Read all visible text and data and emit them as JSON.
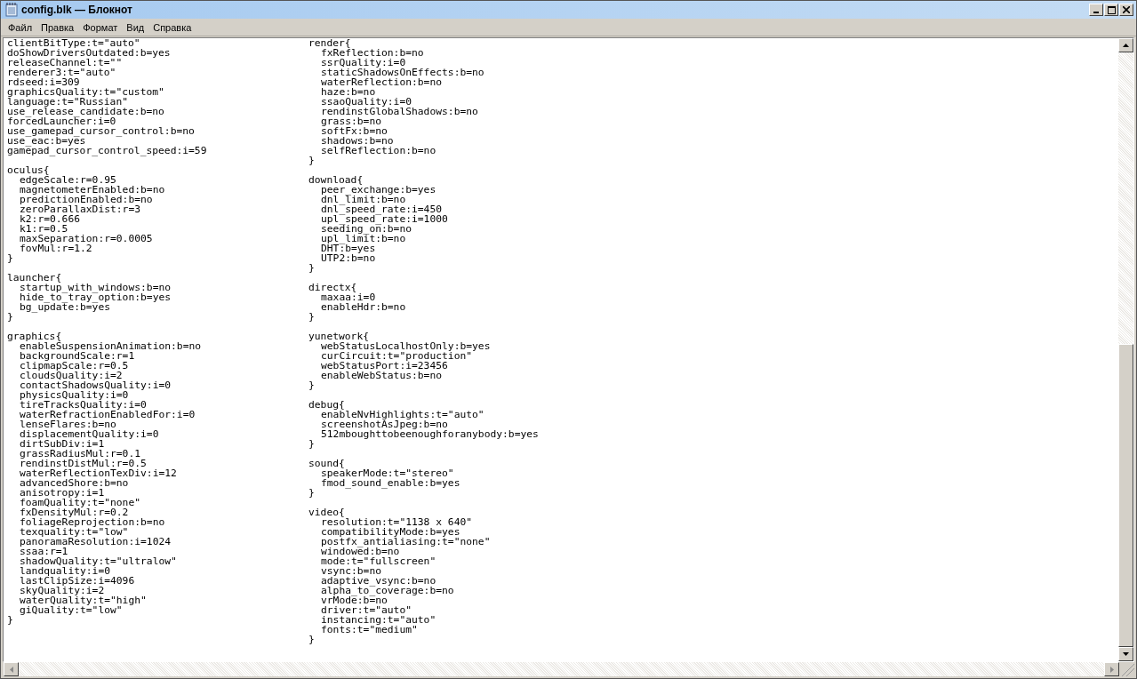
{
  "window": {
    "title": "config.blk — Блокнот"
  },
  "menu": [
    {
      "label": "Файл"
    },
    {
      "label": "Правка"
    },
    {
      "label": "Формат"
    },
    {
      "label": "Вид"
    },
    {
      "label": "Справка"
    }
  ],
  "editor": {
    "columns": [
      [
        {
          "entries": [
            "clientBitType:t=\"auto\"",
            "doShowDriversOutdated:b=yes",
            "releaseChannel:t=\"\"",
            "renderer3:t=\"auto\"",
            "rdseed:i=309",
            "graphicsQuality:t=\"custom\"",
            "language:t=\"Russian\"",
            "use_release_candidate:b=no",
            "forcedLauncher:i=0",
            "use_gamepad_cursor_control:b=no",
            "use_eac:b=yes",
            "gamepad_cursor_control_speed:i=59"
          ]
        },
        {
          "header": "oculus{",
          "entries": [
            "edgeScale:r=0.95",
            "magnetometerEnabled:b=no",
            "predictionEnabled:b=no",
            "zeroParallaxDist:r=3",
            "k2:r=0.666",
            "k1:r=0.5",
            "maxSeparation:r=0.0005",
            "fovMul:r=1.2"
          ],
          "footer": "}"
        },
        {
          "header": "launcher{",
          "entries": [
            "startup_with_windows:b=no",
            "hide_to_tray_option:b=yes",
            "bg_update:b=yes"
          ],
          "footer": "}"
        },
        {
          "header": "graphics{",
          "entries": [
            "enableSuspensionAnimation:b=no",
            "backgroundScale:r=1",
            "clipmapScale:r=0.5",
            "cloudsQuality:i=2",
            "contactShadowsQuality:i=0",
            "physicsQuality:i=0",
            "tireTracksQuality:i=0",
            "waterRefractionEnabledFor:i=0",
            "lenseFlares:b=no",
            "displacementQuality:i=0",
            "dirtSubDiv:i=1",
            "grassRadiusMul:r=0.1",
            "rendinstDistMul:r=0.5",
            "waterReflectionTexDiv:i=12",
            "advancedShore:b=no",
            "anisotropy:i=1",
            "foamQuality:t=\"none\"",
            "fxDensityMul:r=0.2",
            "foliageReprojection:b=no",
            "texquality:t=\"low\"",
            "panoramaResolution:i=1024",
            "ssaa:r=1",
            "shadowQuality:t=\"ultralow\"",
            "landquality:i=0",
            "lastClipSize:i=4096",
            "skyQuality:i=2",
            "waterQuality:t=\"high\"",
            "giQuality:t=\"low\""
          ],
          "footer": "}"
        }
      ],
      [
        {
          "header": "render{",
          "entries": [
            "fxReflection:b=no",
            "ssrQuality:i=0",
            "staticShadowsOnEffects:b=no",
            "waterReflection:b=no",
            "haze:b=no",
            "ssaoQuality:i=0",
            "rendinstGlobalShadows:b=no",
            "grass:b=no",
            "softFx:b=no",
            "shadows:b=no",
            "selfReflection:b=no"
          ],
          "footer": "}"
        },
        {
          "header": "download{",
          "entries": [
            "peer_exchange:b=yes",
            "dnl_limit:b=no",
            "dnl_speed_rate:i=450",
            "upl_speed_rate:i=1000",
            "seeding_on:b=no",
            "upl_limit:b=no",
            "DHT:b=yes",
            "UTP2:b=no"
          ],
          "footer": "}"
        },
        {
          "header": "directx{",
          "entries": [
            "maxaa:i=0",
            "enableHdr:b=no"
          ],
          "footer": "}"
        },
        {
          "header": "yunetwork{",
          "entries": [
            "webStatusLocalhostOnly:b=yes",
            "curCircuit:t=\"production\"",
            "webStatusPort:i=23456",
            "enableWebStatus:b=no"
          ],
          "footer": "}"
        },
        {
          "header": "debug{",
          "entries": [
            "enableNvHighlights:t=\"auto\"",
            "screenshotAsJpeg:b=no",
            "512mboughttobeenoughforanybody:b=yes"
          ],
          "footer": "}"
        },
        {
          "header": "sound{",
          "entries": [
            "speakerMode:t=\"stereo\"",
            "fmod_sound_enable:b=yes"
          ],
          "footer": "}"
        },
        {
          "header": "video{",
          "entries": [
            "resolution:t=\"1138 x 640\"",
            "compatibilityMode:b=yes",
            "postfx_antialiasing:t=\"none\"",
            "windowed:b=no",
            "mode:t=\"fullscreen\"",
            "vsync:b=no",
            "adaptive_vsync:b=no",
            "alpha_to_coverage:b=no",
            "vrMode:b=no",
            "driver:t=\"auto\"",
            "instancing:t=\"auto\"",
            "fonts:t=\"medium\""
          ],
          "footer": "}"
        }
      ]
    ]
  }
}
